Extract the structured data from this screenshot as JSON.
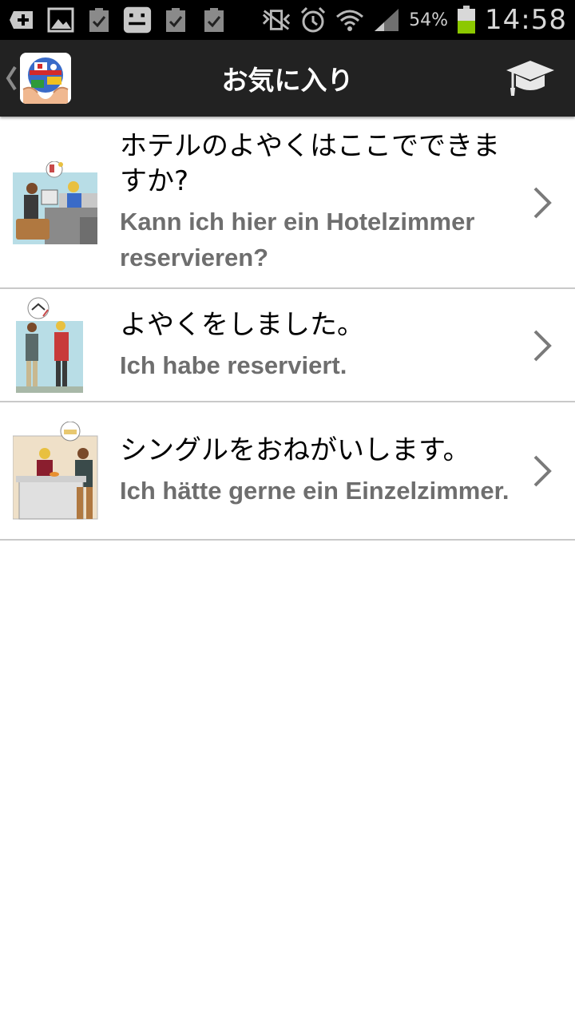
{
  "status_bar": {
    "icons": [
      "add-icon",
      "image-icon",
      "clipboard-check-icon",
      "messenger-icon",
      "clipboard-check-icon",
      "clipboard-check-icon",
      "vibrate-icon",
      "alarm-icon",
      "wifi-icon",
      "signal-icon",
      "battery-icon"
    ],
    "battery_percent": "54%",
    "time": "14:58",
    "battery_color": "#8cc800"
  },
  "action_bar": {
    "title": "お気に入り",
    "back_icon": "chevron-left-icon",
    "logo_icon": "globe-hands-logo",
    "action_icon": "graduation-cap-icon"
  },
  "favorites": [
    {
      "japanese": "ホテルのよやくはここでできますか?",
      "german": "Kann ich hier ein Hotelzimmer reservieren?",
      "illustration": "hotel-reception-illustration"
    },
    {
      "japanese": "よやくをしました。",
      "german": "Ich habe reserviert.",
      "illustration": "reservation-couple-illustration"
    },
    {
      "japanese": "シングルをおねがいします。",
      "german": "Ich hätte gerne ein Einzelzimmer.",
      "illustration": "single-room-request-illustration"
    }
  ],
  "colors": {
    "action_bar": "#222222",
    "status_bar": "#000000",
    "secondary_text": "#6e6e6e",
    "divider": "#c9c9c9"
  }
}
